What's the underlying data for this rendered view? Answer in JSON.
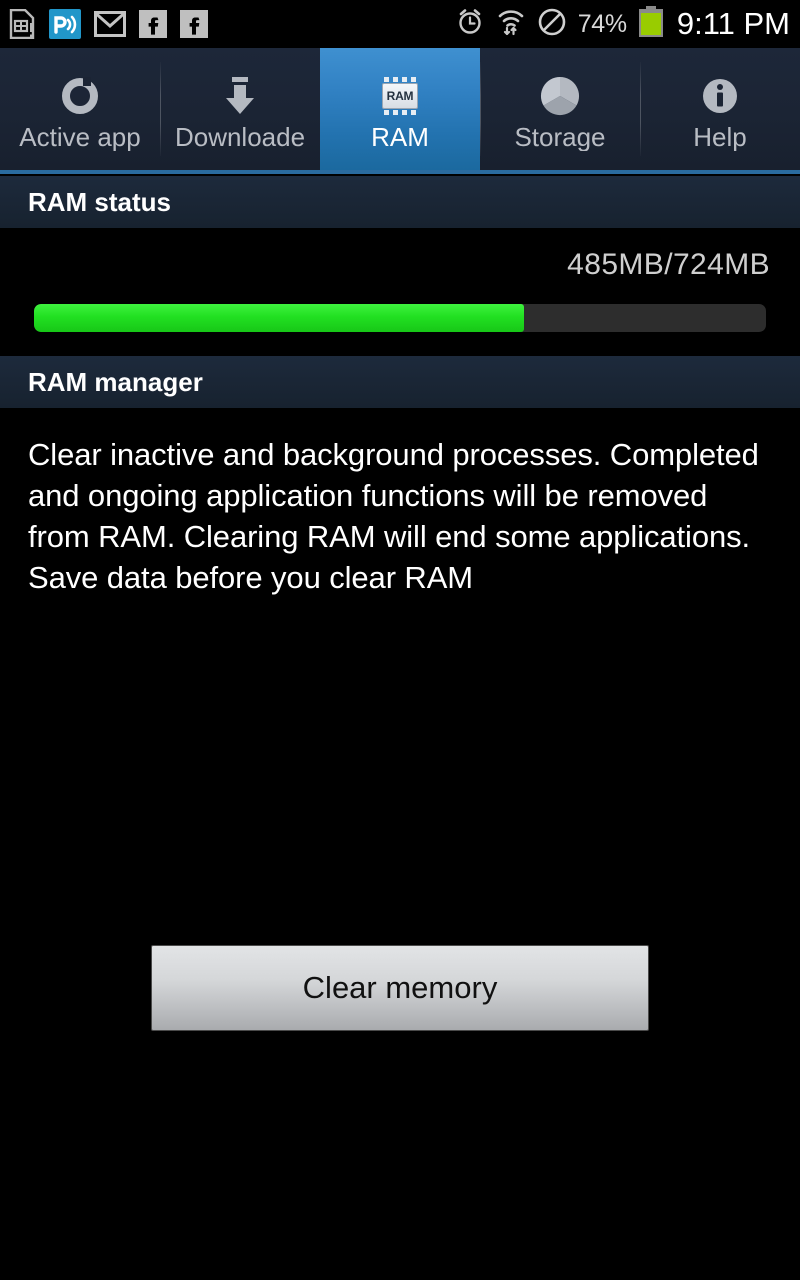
{
  "status_bar": {
    "left_icons": [
      {
        "name": "sim-card-alert-icon",
        "label": "SIM card alert"
      },
      {
        "name": "radio-broadcast-icon",
        "label": "Radio streaming"
      },
      {
        "name": "gmail-icon",
        "label": "Gmail"
      },
      {
        "name": "facebook-icon-1",
        "label": "Facebook"
      },
      {
        "name": "facebook-icon-2",
        "label": "Facebook"
      }
    ],
    "right_icons": [
      {
        "name": "alarm-clock-icon",
        "label": "Alarm set"
      },
      {
        "name": "wifi-transfer-icon",
        "label": "Wi-Fi"
      },
      {
        "name": "mute-icon",
        "label": "Sound off"
      }
    ],
    "battery_percent": "74%",
    "battery_color": "#99cc00",
    "clock": "9:11 PM"
  },
  "tabs": [
    {
      "id": "active-apps",
      "label": "Active app",
      "full_label": "Active apps",
      "icon": "ring-icon",
      "active": false
    },
    {
      "id": "downloaded",
      "label": "Downloade",
      "full_label": "Downloaded",
      "icon": "download-arrow-icon",
      "active": false
    },
    {
      "id": "ram",
      "label": "RAM",
      "full_label": "RAM",
      "icon": "ram-chip-icon",
      "active": true
    },
    {
      "id": "storage",
      "label": "Storage",
      "full_label": "Storage",
      "icon": "pie-chart-icon",
      "active": false
    },
    {
      "id": "help",
      "label": "Help",
      "full_label": "Help",
      "icon": "info-circle-icon",
      "active": false
    }
  ],
  "theme": {
    "active_tab_blue": "#3181c3",
    "accent_line": "#2a6b9e",
    "header_navy": "#1d2a3c",
    "progress_green": "#22e022",
    "progress_track": "#2d2d2d"
  },
  "ram_status": {
    "header": "RAM status",
    "memory_text": "485MB/724MB",
    "used_mb": 485,
    "total_mb": 724,
    "used_percent": 67
  },
  "ram_manager": {
    "header": "RAM manager",
    "description": "Clear inactive and background processes. Completed and ongoing application functions will be removed from RAM. Clearing RAM will end some applications. Save data before you clear RAM",
    "clear_button_label": "Clear memory"
  }
}
